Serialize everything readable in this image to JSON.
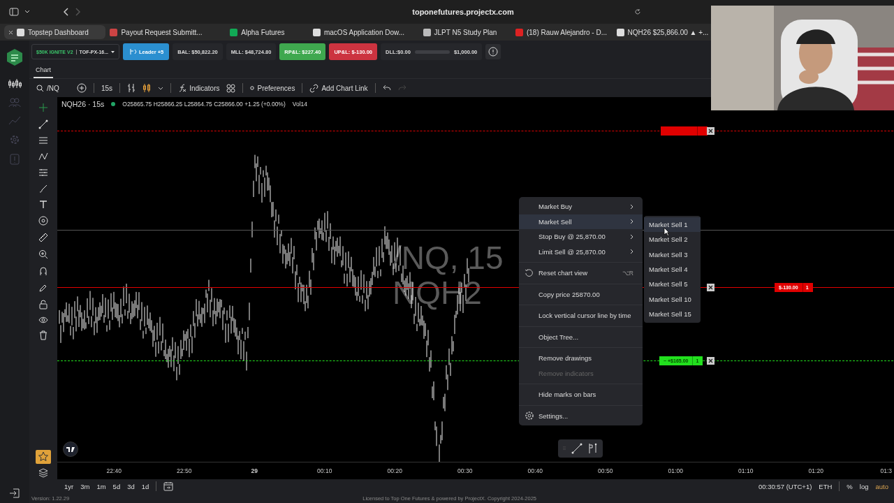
{
  "browser": {
    "url": "toponefutures.projectx.com",
    "tabs": [
      {
        "title": "Topstep Dashboard",
        "selected": true
      },
      {
        "title": "Payout Request Submitt...",
        "selected": false
      },
      {
        "title": "Alpha Futures",
        "selected": false
      },
      {
        "title": "macOS Application Dow...",
        "selected": false
      },
      {
        "title": "JLPT N5 Study Plan",
        "selected": false
      },
      {
        "title": "(18) Rauw Alejandro - D...",
        "selected": false
      },
      {
        "title": "NQH26 $25,866.00 ▲ +...",
        "selected": false
      }
    ]
  },
  "account": {
    "name": "$50K IGNITE V2",
    "id": "TOF-PX-16...",
    "leader": "Leader +5",
    "stats": [
      {
        "label": "BAL: $50,822.20",
        "kind": "plain"
      },
      {
        "label": "MLL: $48,724.80",
        "kind": "plain"
      },
      {
        "label": "RP&L: $227.40",
        "kind": "positive"
      },
      {
        "label": "UP&L: $-130.00",
        "kind": "negative"
      }
    ],
    "dll": {
      "label": "DLL:$0.00",
      "limit": "$1,000.00"
    }
  },
  "panel_tab": {
    "label": "Chart",
    "selected": true
  },
  "toolbar": {
    "symbol": "/NQ",
    "interval": "15s",
    "indicators": "Indicators",
    "preferences": "Preferences",
    "chart_link": "Add Chart Link"
  },
  "legend": {
    "title": "NQH26 · 15s",
    "ohlc": "O25865.75 H25866.25 L25864.75 C25866.00 +1.25 (+0.00%)",
    "volume": "Vol14"
  },
  "watermark": {
    "symbol": "/NQ, 15",
    "name": "NQH2"
  },
  "orders": [
    {
      "kind": "stop",
      "color": "#e00000"
    },
    {
      "kind": "position",
      "pnl": "$-130.00",
      "qty": "1",
      "color": "#e00000"
    },
    {
      "kind": "target",
      "pnl": "~ +$165.00",
      "qty": "1",
      "color": "#22e01e"
    }
  ],
  "context_menu": {
    "groups": [
      [
        {
          "label": "Market Buy",
          "kind": "submenu",
          "selected": false,
          "disabled": false
        },
        {
          "label": "Market Sell",
          "kind": "submenu",
          "selected": true,
          "disabled": false
        },
        {
          "label": "Stop Buy @ 25,870.00",
          "kind": "submenu",
          "selected": false,
          "disabled": false
        },
        {
          "label": "Limit Sell @ 25,870.00",
          "kind": "submenu",
          "selected": false,
          "disabled": false
        }
      ],
      [
        {
          "label": "Reset chart view",
          "kind": "reset",
          "shortcut": "⌥R",
          "selected": false,
          "disabled": false
        }
      ],
      [
        {
          "label": "Copy price 25870.00",
          "kind": "item",
          "selected": false,
          "disabled": false
        }
      ],
      [
        {
          "label": "Lock vertical cursor line by time",
          "kind": "item",
          "selected": false,
          "disabled": false
        }
      ],
      [
        {
          "label": "Object Tree...",
          "kind": "item",
          "selected": false,
          "disabled": false
        }
      ],
      [
        {
          "label": "Remove drawings",
          "kind": "item",
          "selected": false,
          "disabled": false
        },
        {
          "label": "Remove indicators",
          "kind": "item",
          "selected": false,
          "disabled": true
        }
      ],
      [
        {
          "label": "Hide marks on bars",
          "kind": "item",
          "selected": false,
          "disabled": false
        }
      ],
      [
        {
          "label": "Settings...",
          "kind": "settings",
          "selected": false,
          "disabled": false
        }
      ]
    ],
    "submenu": [
      {
        "label": "Market Sell 1",
        "selected": true
      },
      {
        "label": "Market Sell 2",
        "selected": false
      },
      {
        "label": "Market Sell 3",
        "selected": false
      },
      {
        "label": "Market Sell 4",
        "selected": false
      },
      {
        "label": "Market Sell 5",
        "selected": false
      },
      {
        "label": "Market Sell 10",
        "selected": false
      },
      {
        "label": "Market Sell 15",
        "selected": false
      }
    ]
  },
  "time_axis": [
    {
      "text": "22:40",
      "kind": "time"
    },
    {
      "text": "22:50",
      "kind": "time"
    },
    {
      "text": "29",
      "kind": "day"
    },
    {
      "text": "00:10",
      "kind": "time"
    },
    {
      "text": "00:20",
      "kind": "time"
    },
    {
      "text": "00:30",
      "kind": "time"
    },
    {
      "text": "00:40",
      "kind": "time"
    },
    {
      "text": "00:50",
      "kind": "time"
    },
    {
      "text": "01:00",
      "kind": "time"
    },
    {
      "text": "01:10",
      "kind": "time"
    },
    {
      "text": "01:20",
      "kind": "time"
    },
    {
      "text": "01:3",
      "kind": "time"
    }
  ],
  "ranges": [
    "1yr",
    "3m",
    "1m",
    "5d",
    "3d",
    "1d"
  ],
  "status": {
    "time": "00:30:57 (UTC+1)",
    "session": "ETH",
    "scales": [
      {
        "label": "%",
        "selected": false
      },
      {
        "label": "log",
        "selected": false
      },
      {
        "label": "auto",
        "selected": true
      }
    ]
  },
  "footer": {
    "version": "Version: 1.22.29",
    "license": "Licensed to Top One Futures & powered by ProjectX. Copyright 2024-2025"
  },
  "webcam": {
    "kind": "picture"
  }
}
